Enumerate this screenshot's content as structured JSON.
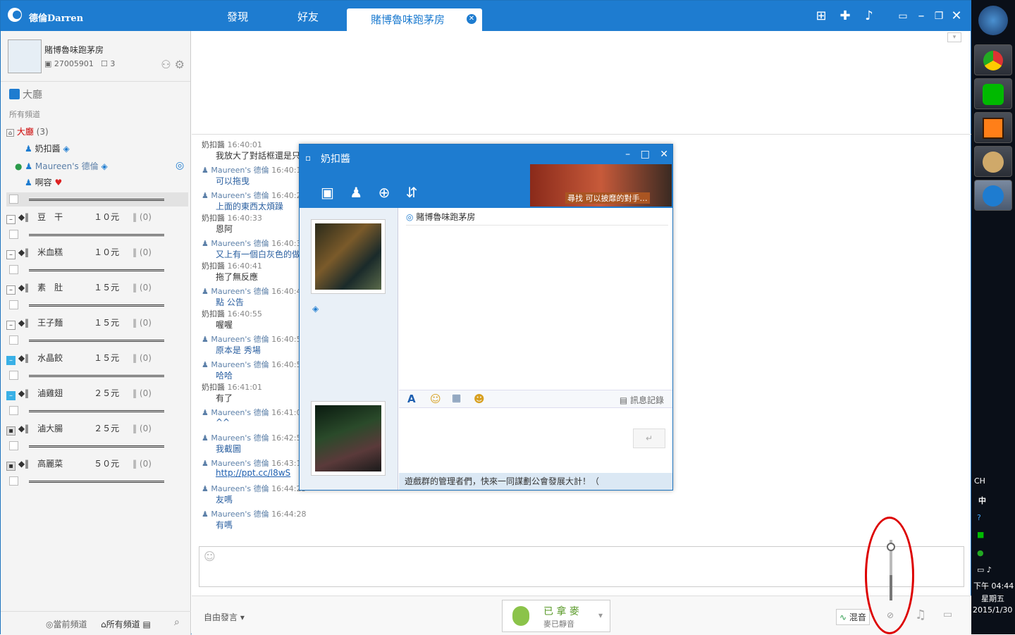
{
  "topbar": {
    "username": "德倫Darren",
    "tabs": [
      {
        "label": "發現"
      },
      {
        "label": "好友"
      },
      {
        "label": "賭博魯味跑茅房"
      }
    ]
  },
  "profile": {
    "name": "賭博魯味跑茅房",
    "id": "27005901",
    "count": "3"
  },
  "sidebar": {
    "section_title": "大廳",
    "all_channels": "所有頻道",
    "lobby_row": {
      "name": "大廳",
      "count": "(3)"
    },
    "members": [
      {
        "name": "奶扣醬"
      },
      {
        "name": "Maureen's 德倫"
      },
      {
        "name": "啊容"
      }
    ],
    "channels": [
      {
        "mark": "◆‖",
        "name": "豆　干",
        "price": "１０元",
        "count": "‖ (0)"
      },
      {
        "mark": "◆‖",
        "name": "米血糕",
        "price": "１０元",
        "count": "‖ (0)"
      },
      {
        "mark": "◆‖",
        "name": "素　肚",
        "price": "１５元",
        "count": "‖ (0)"
      },
      {
        "mark": "◆‖",
        "name": "王子麵",
        "price": "１５元",
        "count": "‖ (0)"
      },
      {
        "mark": "◆‖",
        "name": "水晶餃",
        "price": "１５元",
        "count": "‖ (0)"
      },
      {
        "mark": "◆‖",
        "name": "滷雞翅",
        "price": "２５元",
        "count": "‖ (0)"
      },
      {
        "mark": "◆‖",
        "name": "滷大腸",
        "price": "２５元",
        "count": "‖ (0)"
      },
      {
        "mark": "◆‖",
        "name": "高麗菜",
        "price": "５０元",
        "count": "‖ (0)"
      }
    ],
    "footer": {
      "current": "當前頻道",
      "all": "所有頻道"
    }
  },
  "messages": [
    {
      "who": "奶扣醬",
      "time": "16:40:01",
      "text": "我放大了對話框還是只"
    },
    {
      "who": "Maureen's 德倫",
      "time": "16:40:14",
      "text": "可以拖曳"
    },
    {
      "who": "Maureen's 德倫",
      "time": "16:40:24",
      "text": "上面的東西太煩躁"
    },
    {
      "who": "奶扣醬",
      "time": "16:40:33",
      "text": "恩阿"
    },
    {
      "who": "Maureen's 德倫",
      "time": "16:40:37",
      "text": "又上有一個白灰色的做"
    },
    {
      "who": "奶扣醬",
      "time": "16:40:41",
      "text": "拖了無反應"
    },
    {
      "who": "Maureen's 德倫",
      "time": "16:40:47",
      "text": "點 公告"
    },
    {
      "who": "奶扣醬",
      "time": "16:40:55",
      "text": "喔喔"
    },
    {
      "who": "Maureen's 德倫",
      "time": "16:40:55",
      "text": "原本是 秀場"
    },
    {
      "who": "Maureen's 德倫",
      "time": "16:40:57",
      "text": "哈哈"
    },
    {
      "who": "奶扣醬",
      "time": "16:41:01",
      "text": "有了"
    },
    {
      "who": "Maureen's 德倫",
      "time": "16:41:05",
      "text": "^^"
    },
    {
      "who": "Maureen's 德倫",
      "time": "16:42:55",
      "text": "我截圖"
    },
    {
      "who": "Maureen's 德倫",
      "time": "16:43:18",
      "text": "http://ppt.cc/l8wS"
    },
    {
      "who": "Maureen's 德倫",
      "time": "16:44:25",
      "text": "友嗎"
    },
    {
      "who": "Maureen's 德倫",
      "time": "16:44:28",
      "text": "有嗎"
    }
  ],
  "bottombar": {
    "mode": "自由發言",
    "mic_label": "已 拿 麥",
    "mic_sub": "麥已靜音",
    "mix_label": "混音"
  },
  "popup": {
    "title": "奶扣醬",
    "ad_text": "尋找 可以披靡的對手…",
    "room": "賭博魯味跑茅房",
    "history": "訊息記錄",
    "footer_text": "遊戲群的管理者們，快來一同謀劃公會發展大計！（"
  },
  "tray": {
    "lang": "CH",
    "ime": "中",
    "time": "下午 04:44",
    "weekday": "星期五",
    "date": "2015/1/30"
  }
}
